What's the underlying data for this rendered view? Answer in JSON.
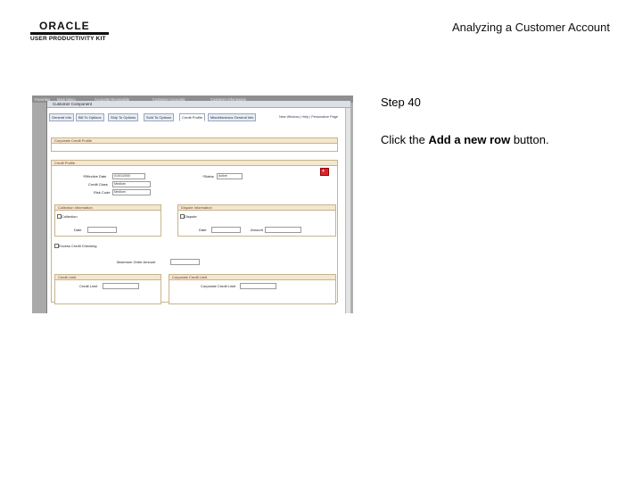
{
  "header": {
    "logo_text": "ORACLE",
    "logo_subtext": "USER PRODUCTIVITY KIT",
    "page_title": "Analyzing a Customer Account"
  },
  "step": {
    "label": "Step 40",
    "instruction_prefix": "Click the ",
    "instruction_target": "Add a new row",
    "instruction_suffix": " button."
  },
  "screenshot": {
    "window_title": "Customer Component",
    "tabs": [
      "General Info",
      "Bill To Options",
      "Ship To Options",
      "Sold To Options",
      "Credit Profile",
      "Miscellaneous General Info"
    ],
    "active_tab": "Credit Profile",
    "top_links": "New Window | Help | Personalize Page",
    "sections": [
      "Corporate Credit Profile",
      "Credit Profile",
      "Collection Information",
      "Dispute Information",
      "Credit Limit",
      "Corporate Credit Limit"
    ],
    "fields": {
      "effective_date_label": "*Effective Date",
      "effective_date_value": "01/01/2000",
      "status_label": "*Status",
      "status_value": "Active",
      "credit_class_label": "Credit Class",
      "credit_class_value": "Medium",
      "risk_code_label": "Risk Code",
      "risk_code_value": "Medium",
      "collection_label": "Collection",
      "dispute_label": "Dispute",
      "excess_credit_label": "Excess Credit Checking",
      "max_order_label": "Maximum Order Amount",
      "credit_limit_label": "Credit Limit",
      "corp_credit_limit_label": "Corporate Credit Limit",
      "date_label": "Date",
      "amount_label": "Amount"
    },
    "add_button_icon": "add-row-icon"
  }
}
